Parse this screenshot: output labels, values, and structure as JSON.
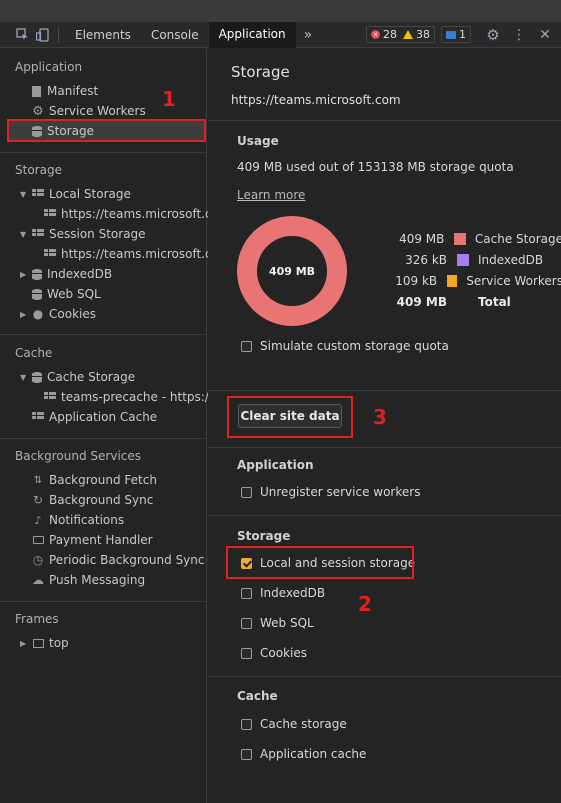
{
  "toolbar": {
    "tabs": [
      "Elements",
      "Console",
      "Application"
    ],
    "more": "»",
    "errors": "28",
    "warnings": "38",
    "messages": "1"
  },
  "sidebar": {
    "application": {
      "title": "Application",
      "items": [
        "Manifest",
        "Service Workers",
        "Storage"
      ]
    },
    "storage": {
      "title": "Storage",
      "local_storage": "Local Storage",
      "local_storage_child": "https://teams.microsoft.com",
      "session_storage": "Session Storage",
      "session_storage_child": "https://teams.microsoft.com",
      "indexeddb": "IndexedDB",
      "websql": "Web SQL",
      "cookies": "Cookies"
    },
    "cache": {
      "title": "Cache",
      "cache_storage": "Cache Storage",
      "cache_storage_child": "teams-precache - https://teams.microsoft.com",
      "application_cache": "Application Cache"
    },
    "background": {
      "title": "Background Services",
      "items": [
        "Background Fetch",
        "Background Sync",
        "Notifications",
        "Payment Handler",
        "Periodic Background Sync",
        "Push Messaging"
      ]
    },
    "frames": {
      "title": "Frames",
      "top": "top"
    }
  },
  "main": {
    "title": "Storage",
    "url": "https://teams.microsoft.com",
    "usage": {
      "heading": "Usage",
      "summary": "409 MB used out of 153138 MB storage quota",
      "learn_more": "Learn more",
      "donut_label": "409 MB",
      "legend": [
        {
          "value": "409 MB",
          "name": "Cache Storage",
          "color": "#e87474"
        },
        {
          "value": "326 kB",
          "name": "IndexedDB",
          "color": "#a37ff0"
        },
        {
          "value": "109 kB",
          "name": "Service Workers",
          "color": "#f5a623"
        }
      ],
      "total_value": "409 MB",
      "total_label": "Total",
      "simulate": "Simulate custom storage quota"
    },
    "clear_button": "Clear site data",
    "application": {
      "heading": "Application",
      "unregister": "Unregister service workers"
    },
    "storage": {
      "heading": "Storage",
      "local_session": "Local and session storage",
      "indexeddb": "IndexedDB",
      "websql": "Web SQL",
      "cookies": "Cookies"
    },
    "cache": {
      "heading": "Cache",
      "cache_storage": "Cache storage",
      "application_cache": "Application cache"
    }
  },
  "annotations": {
    "one": "1",
    "two": "2",
    "three": "3"
  },
  "colors": {
    "annotation_red": "#e02020",
    "checkbox_on": "#f0a830",
    "donut": "#e87474"
  }
}
